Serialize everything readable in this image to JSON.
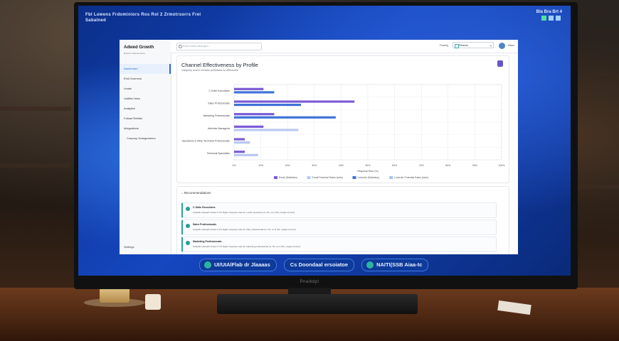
{
  "screen": {
    "header_lines": [
      "Fbl Lowens  Frdominiors  Ros Rol 2  Zrmotrsorrs  Frei",
      "Sabalned"
    ],
    "header_right": "Bla Bra Brt 4"
  },
  "app": {
    "title": "Adwed Growth",
    "subtitle": "Ensrsle Channel Zone",
    "nav": [
      {
        "label": "Dashboard",
        "active": true
      },
      {
        "label": "Emil Overreck"
      },
      {
        "label": "Leads"
      },
      {
        "label": "Untified Inics"
      },
      {
        "label": "Analytics"
      },
      {
        "label": "Fobset Rebitst"
      },
      {
        "label": "Integrations"
      },
      {
        "label": "Conproy Grangemenrs",
        "sub": true
      }
    ],
    "settings_label": "Settings",
    "search_placeholder": "Seeet leads uampagns...",
    "view_label": "Fiowing",
    "view_value": "Rebinds",
    "user_label": "Dtson"
  },
  "card": {
    "title": "Channel Effectiveness by Profile",
    "subtitle": "Camperiy moel ir Inrhsrttc psrlodistes ko effectotVle"
  },
  "chart_data": {
    "type": "bar",
    "orientation": "horizontal",
    "categories": [
      "C-Sulte Executives",
      "Sales Professionals",
      "Marketing Professionals",
      "Admirise Managerst",
      "Operations & Other Technical Professionals",
      "Technical Specialists"
    ],
    "x_ticks": [
      "0%",
      "10%",
      "20%",
      "30%",
      "40%",
      "50%",
      "60%",
      "70%",
      "80%",
      "90%",
      "100%"
    ],
    "xlim": [
      0,
      100
    ],
    "xlabel": "Respasal Rare (%)",
    "series": [
      {
        "name": "Email (Statistics)",
        "color": "#7b5cd6",
        "values": [
          11,
          45,
          15,
          11,
          4,
          4
        ]
      },
      {
        "name": "Email Potential Rates (bets)",
        "color": "#b9c8f0",
        "values": [
          0,
          0,
          0,
          24,
          6,
          9
        ]
      },
      {
        "name": "LinkedIn (Statistics)",
        "color": "#3f73d6",
        "values": [
          15,
          25,
          38,
          0,
          0,
          0
        ]
      },
      {
        "name": "LinkedIn Potential Rates (bets)",
        "color": "#9fc3ee",
        "values": [
          0,
          0,
          0,
          0,
          0,
          0
        ]
      }
    ],
    "grid": true,
    "legend": "bottom"
  },
  "recommendations": {
    "title": "Recommendations",
    "items": [
      {
        "name": "C-Sulte Executives",
        "text": "LinkedIn outreach shows 3.7% higher response rate for c-suite executives (LI 7%, vs LI 3%, margin of error)"
      },
      {
        "name": "Sales Professionals",
        "text": "LinkedIn outreach shows 3.7% higher response rate for other professionals (LI 7%, vs LI 3%, margin of error)"
      },
      {
        "name": "Marketing Professionals",
        "text": "LinkedIn outreach shows 3.7% higher response rate for marketing professionals (LI 7%, vs LI 3%, margin of error)"
      }
    ]
  },
  "taskbar": [
    {
      "label": "UI/UIAlFlab dr Jlaaaas"
    },
    {
      "label": "Cs Doondaal ersoiatoe"
    },
    {
      "label": "NAITI(SSB Aiaa-tc"
    }
  ],
  "monitor_brand": "Pnaikdpi"
}
